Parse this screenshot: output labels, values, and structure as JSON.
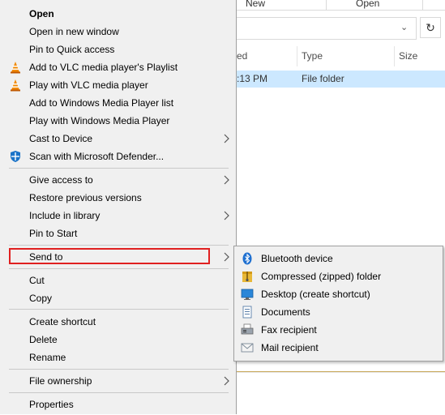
{
  "explorer": {
    "ribbon": {
      "new_label": "New",
      "open_label": "Open"
    },
    "address": {
      "dropdown_glyph": "⌄",
      "refresh_glyph": "↻"
    },
    "columns": {
      "date_partial": "ed",
      "type": "Type",
      "size": "Size"
    },
    "selected_row": {
      "date_partial": ":13 PM",
      "type": "File folder"
    }
  },
  "menu": {
    "items": [
      {
        "label": "Open"
      },
      {
        "label": "Open in new window"
      },
      {
        "label": "Pin to Quick access"
      },
      {
        "label": "Add to VLC media player's Playlist",
        "icon": "vlc-icon"
      },
      {
        "label": "Play with VLC media player",
        "icon": "vlc-icon"
      },
      {
        "label": "Add to Windows Media Player list"
      },
      {
        "label": "Play with Windows Media Player"
      },
      {
        "label": "Cast to Device"
      },
      {
        "label": "Scan with Microsoft Defender...",
        "icon": "defender-icon"
      },
      {
        "label": "Give access to"
      },
      {
        "label": "Restore previous versions"
      },
      {
        "label": "Include in library"
      },
      {
        "label": "Pin to Start"
      },
      {
        "label": "Send to"
      },
      {
        "label": "Cut"
      },
      {
        "label": "Copy"
      },
      {
        "label": "Create shortcut"
      },
      {
        "label": "Delete"
      },
      {
        "label": "Rename"
      },
      {
        "label": "File ownership"
      },
      {
        "label": "Properties"
      }
    ]
  },
  "submenu": {
    "items": [
      {
        "label": "Bluetooth device",
        "icon": "bluetooth-icon"
      },
      {
        "label": "Compressed (zipped) folder",
        "icon": "zip-folder-icon"
      },
      {
        "label": "Desktop (create shortcut)",
        "icon": "desktop-icon"
      },
      {
        "label": "Documents",
        "icon": "documents-icon"
      },
      {
        "label": "Fax recipient",
        "icon": "fax-icon"
      },
      {
        "label": "Mail recipient",
        "icon": "mail-icon"
      }
    ]
  },
  "colors": {
    "highlight_border": "#e02020",
    "selection": "#cce8ff",
    "menu_bg": "#f0f0f0"
  }
}
